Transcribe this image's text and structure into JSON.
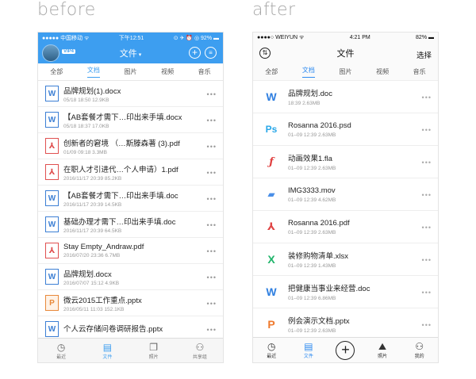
{
  "captions": {
    "before": "before",
    "after": "after"
  },
  "before": {
    "status": {
      "carrier": "●●●●● 中国移动 ᯤ",
      "time": "下午12:51",
      "battery": "⊙ ✈ ⏰ ◎ 92% ▬"
    },
    "header": {
      "vip": "VIP4",
      "title": "文件",
      "caret": "▾",
      "add_icon": "+",
      "list_icon": "≡"
    },
    "tabs": [
      "全部",
      "文档",
      "图片",
      "视频",
      "音乐"
    ],
    "files": [
      {
        "icon": "W",
        "type": "w",
        "name": "品牌规划(1).docx",
        "meta": "05/18 18:50   12.9KB"
      },
      {
        "icon": "W",
        "type": "w",
        "name": "【AB套餐才需下…印出来手填.docx",
        "meta": "05/18 18:37   17.0KB"
      },
      {
        "icon": "⅄",
        "type": "pdf",
        "name": "创新者的窘境 （…斯滕森著 (3).pdf",
        "meta": "01/09 09:18   3.3MB"
      },
      {
        "icon": "⅄",
        "type": "pdf",
        "name": "在职人才引进代…个人申请）1.pdf",
        "meta": "2016/11/17 20:39   85.2KB"
      },
      {
        "icon": "W",
        "type": "w",
        "name": "【AB套餐才需下…印出来手填.doc",
        "meta": "2016/11/17 20:39   14.5KB"
      },
      {
        "icon": "W",
        "type": "w",
        "name": "基础办理才需下…印出来手填.doc",
        "meta": "2016/11/17 20:39   64.5KB"
      },
      {
        "icon": "⅄",
        "type": "pdf",
        "name": "Stay Empty_Andraw.pdf",
        "meta": "2016/07/20 23:36   6.7MB"
      },
      {
        "icon": "W",
        "type": "w",
        "name": "品牌规划.docx",
        "meta": "2016/07/07 15:12   4.9KB"
      },
      {
        "icon": "P",
        "type": "p",
        "name": "微云2015工作重点.pptx",
        "meta": "2016/05/11 11:03   152.1KB"
      },
      {
        "icon": "W",
        "type": "w",
        "name": "个人云存储问卷调研报告.pptx",
        "meta": ""
      }
    ],
    "more": "•••",
    "tabbar": [
      {
        "icon": "◷",
        "label": "最近",
        "active": false
      },
      {
        "icon": "▤",
        "label": "文件",
        "active": true
      },
      {
        "icon": "❐",
        "label": "照片",
        "active": false
      },
      {
        "icon": "⚇",
        "label": "共享组",
        "active": false
      }
    ]
  },
  "after": {
    "status": {
      "carrier": "●●●●○ WEIYUN ᯤ",
      "time": "4:21 PM",
      "battery": "82% ▬"
    },
    "header": {
      "sort_icon": "⇅",
      "title": "文件",
      "select": "选择"
    },
    "tabs": [
      "全部",
      "文档",
      "图片",
      "视频",
      "音乐"
    ],
    "files": [
      {
        "icon": "W",
        "type": "w",
        "name": "品牌规划.doc",
        "meta": "18:39 2.63MB"
      },
      {
        "icon": "Ps",
        "type": "ps",
        "name": "Rosanna 2016.psd",
        "meta": "01–09 12:39 2.63MB"
      },
      {
        "icon": "ƒ",
        "type": "fla",
        "name": "动画效果1.fla",
        "meta": "01–09 12:39 2.63MB"
      },
      {
        "icon": "▰",
        "type": "mov",
        "name": "IMG3333.mov",
        "meta": "01–09 12:39 4.62MB"
      },
      {
        "icon": "⅄",
        "type": "pdf",
        "name": "Rosanna 2016.pdf",
        "meta": "01–09 12:39 2.63MB"
      },
      {
        "icon": "X",
        "type": "x",
        "name": "装修购物清单.xlsx",
        "meta": "01–09 12:39 1.43MB"
      },
      {
        "icon": "W",
        "type": "w",
        "name": "把健康当事业来经营.doc",
        "meta": "01–09 12:39 6.86MB"
      },
      {
        "icon": "P",
        "type": "p",
        "name": "例会演示文档.pptx",
        "meta": "01–09 12:39 2.63MB"
      }
    ],
    "more": "•••",
    "tabbar": [
      {
        "icon": "◷",
        "label": "最近",
        "active": false
      },
      {
        "icon": "▤",
        "label": "文件",
        "active": true
      },
      {
        "icon": "+",
        "label": "",
        "active": false,
        "plus": true
      },
      {
        "icon": "⛰",
        "label": "照片",
        "active": false
      },
      {
        "icon": "⚇",
        "label": "我的",
        "active": false
      }
    ]
  }
}
